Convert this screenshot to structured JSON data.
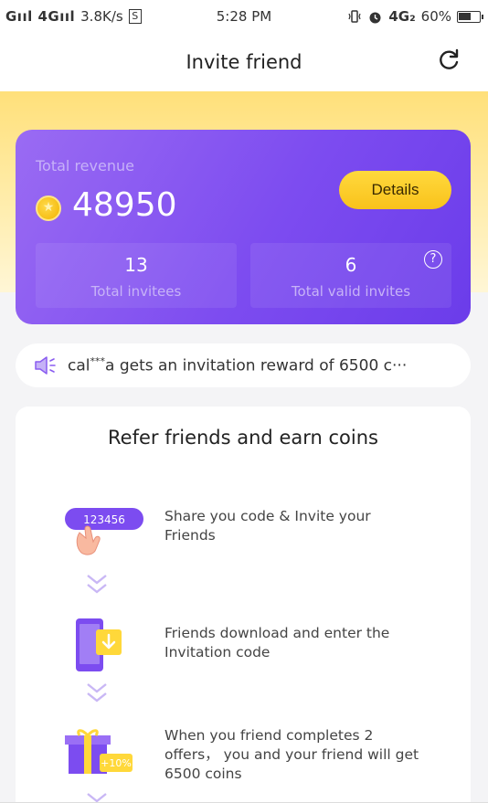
{
  "status_bar": {
    "signal_left": "Gııl 4Gııl",
    "speed": "3.8K/s",
    "s_icon": "S",
    "time": "5:28 PM",
    "network": "4G₂",
    "battery": "60%",
    "battery_level": 0.6,
    "icons": [
      "vibrate-icon",
      "alarm-icon",
      "battery-icon"
    ]
  },
  "header": {
    "title": "Invite friend",
    "refresh_icon": "refresh-icon"
  },
  "revenue": {
    "label": "Total revenue",
    "amount": "48950",
    "details_label": "Details",
    "stats": [
      {
        "value": "13",
        "caption": "Total invitees"
      },
      {
        "value": "6",
        "caption": "Total valid invites"
      }
    ],
    "help_glyph": "?"
  },
  "marquee": {
    "name_start": "cal",
    "mask": "***",
    "message": "a gets an invitation reward of 6500 c···"
  },
  "refer": {
    "title": "Refer friends and earn coins",
    "code_sample": "123456",
    "bonus": "+10%",
    "steps": [
      {
        "line1": "Share you code & Invite your",
        "line2": "Friends"
      },
      {
        "line1": "Friends download and enter the",
        "line2": "Invitation code"
      },
      {
        "line1": "When you friend completes 2",
        "line2": "offers， you and your friend will get",
        "line3": "6500 coins"
      }
    ]
  },
  "colors": {
    "purple": "#7d4cf0",
    "yellow_button": "#f9c21b",
    "banner": "#ffe07a"
  }
}
